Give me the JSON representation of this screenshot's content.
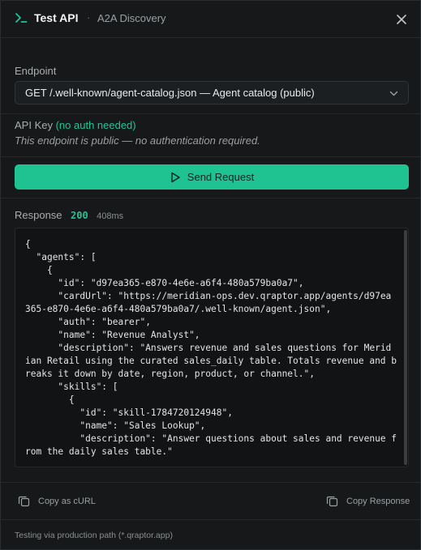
{
  "header": {
    "title": "Test API",
    "separator": "·",
    "subtitle": "A2A Discovery"
  },
  "endpoint": {
    "label": "Endpoint",
    "selected": "GET /.well-known/agent-catalog.json — Agent catalog (public)"
  },
  "api_key": {
    "label": "API Key",
    "note": "(no auth needed)",
    "description": "This endpoint is public — no authentication required."
  },
  "send_button": {
    "label": "Send Request"
  },
  "response": {
    "label": "Response",
    "status": "200",
    "time": "408ms",
    "body": "{\n  \"agents\": [\n    {\n      \"id\": \"d97ea365-e870-4e6e-a6f4-480a579ba0a7\",\n      \"cardUrl\": \"https://meridian-ops.dev.qraptor.app/agents/d97ea365-e870-4e6e-a6f4-480a579ba0a7/.well-known/agent.json\",\n      \"auth\": \"bearer\",\n      \"name\": \"Revenue Analyst\",\n      \"description\": \"Answers revenue and sales questions for Meridian Retail using the curated sales_daily table. Totals revenue and breaks it down by date, region, product, or channel.\",\n      \"skills\": [\n        {\n          \"id\": \"skill-1784720124948\",\n          \"name\": \"Sales Lookup\",\n          \"description\": \"Answer questions about sales and revenue from the daily sales table.\""
  },
  "actions": {
    "copy_curl": "Copy as cURL",
    "copy_response": "Copy Response"
  },
  "footer": {
    "text": "Testing via production path (*.qraptor.app)"
  },
  "colors": {
    "accent": "#1fc392",
    "background": "#161819",
    "status_ok": "#22c497"
  },
  "icons": {
    "title": "terminal-prompt-icon",
    "close": "close-icon",
    "dropdown": "chevron-down-icon",
    "send": "play-icon",
    "copy": "copy-icon"
  }
}
